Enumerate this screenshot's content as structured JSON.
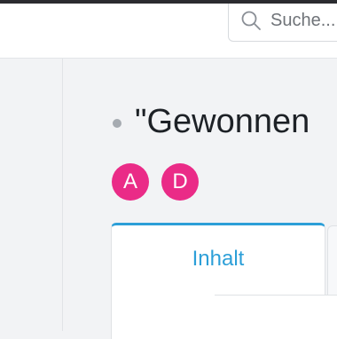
{
  "header": {
    "search": {
      "placeholder": "Suche...",
      "icon": "search-icon"
    }
  },
  "page": {
    "title": "\"Gewonnen",
    "status_color": "#a6abb1"
  },
  "avatars": [
    {
      "initial": "A",
      "color": "#ea2b87"
    },
    {
      "initial": "D",
      "color": "#ea2b87"
    }
  ],
  "tabs": [
    {
      "label": "Inhalt",
      "active": true
    }
  ],
  "colors": {
    "accent": "#2c9fd8",
    "avatar": "#ea2b87",
    "title_text": "#1d2126"
  }
}
